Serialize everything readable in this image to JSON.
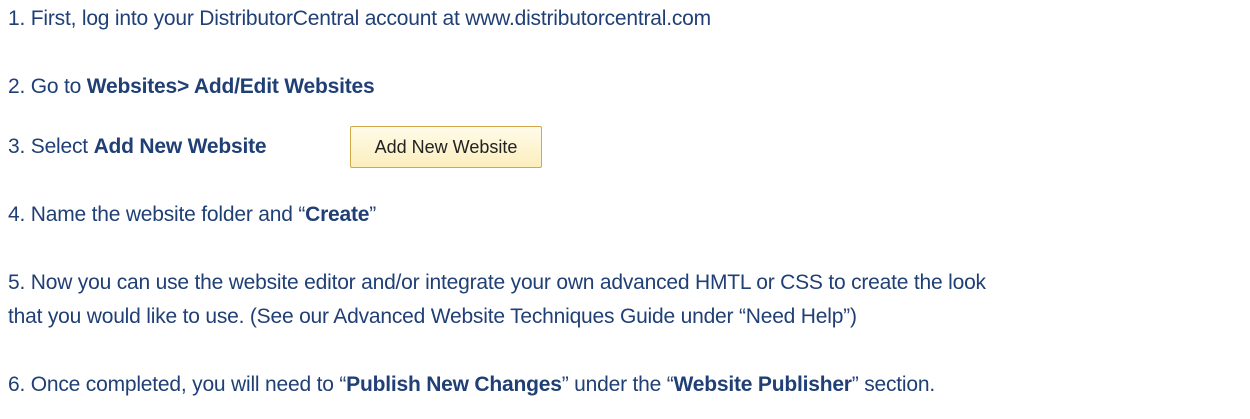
{
  "steps": {
    "s1": {
      "num": "1.",
      "text": " First, log into your DistributorCentral account at www.distributorcentral.com"
    },
    "s2": {
      "num": "2.",
      "pre": " Go to ",
      "bold": "Websites> Add/Edit Websites"
    },
    "s3": {
      "num": "3.",
      "pre": " Select ",
      "bold": "Add New Website",
      "button_label": "Add New Website"
    },
    "s4": {
      "num": "4.",
      "pre": " Name the website folder and “",
      "bold": "Create",
      "post": "”"
    },
    "s5": {
      "num": "5.",
      "line1": " Now you can use the website editor and/or integrate your own advanced HMTL or CSS to create the look",
      "line2": "that you would like to use. (See our Advanced Website Techniques Guide under “Need Help”)"
    },
    "s6": {
      "num": "6.",
      "pre": " Once completed, you will need to “",
      "bold1": "Publish New Changes",
      "mid": "” under the “",
      "bold2": "Website Publisher",
      "post": "” section."
    }
  }
}
